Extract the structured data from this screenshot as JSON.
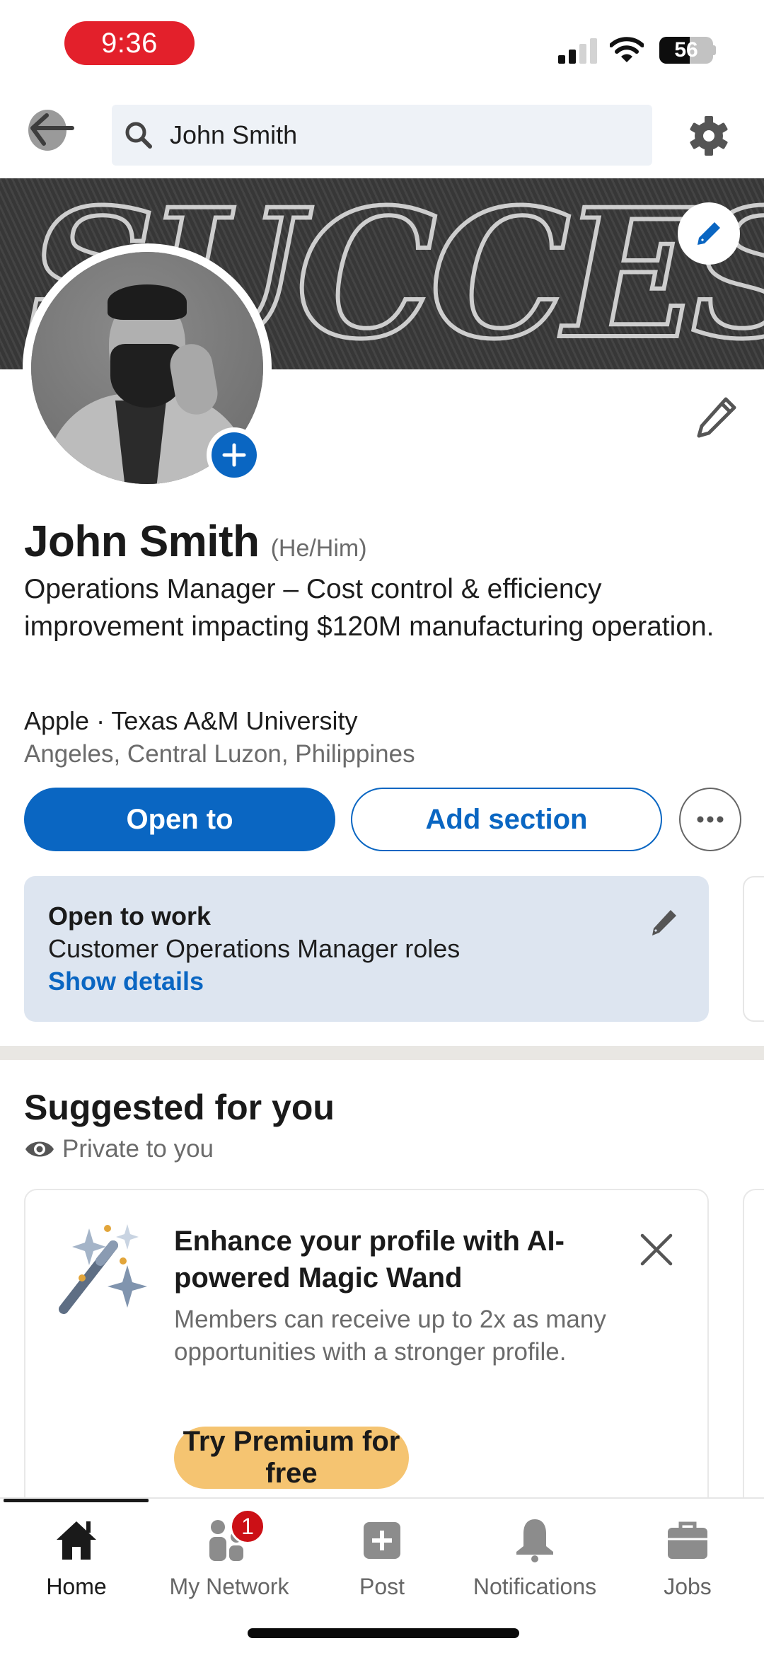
{
  "status_bar": {
    "time": "9:36",
    "battery_level": "56",
    "battery_fraction": 0.56,
    "signal_bars_active": 2,
    "signal_bars_total": 4,
    "icons": [
      "cellular-signal-icon",
      "wifi-icon",
      "battery-icon"
    ]
  },
  "top_nav": {
    "back_icon": "arrow-left-icon",
    "search_icon": "search-icon",
    "search_value": "John Smith",
    "settings_icon": "gear-icon"
  },
  "banner": {
    "image_text": "SUCCESS",
    "edit_icon": "pencil-icon"
  },
  "profile": {
    "add_photo_icon": "plus-icon",
    "edit_intro_icon": "pencil-icon",
    "name": "John Smith",
    "pronouns": "(He/Him)",
    "headline": "Operations Manager – Cost control & efficiency improvement impacting $120M manufacturing operation.",
    "affiliations": "Apple · Texas A&M University",
    "location": "Angeles, Central Luzon, Philippines"
  },
  "actions": {
    "open_to": "Open to",
    "add_section": "Add section",
    "more_icon": "more-horizontal-icon"
  },
  "open_to_work": {
    "title": "Open to work",
    "roles": "Customer Operations Manager roles",
    "link": "Show details",
    "edit_icon": "pencil-icon"
  },
  "suggested": {
    "title": "Suggested for you",
    "privacy": "Private to you",
    "privacy_icon": "eye-icon",
    "card": {
      "icon": "magic-wand-icon",
      "title": "Enhance your profile with AI-powered Magic Wand",
      "body": "Members can receive up to 2x as many opportunities with a stronger profile.",
      "cta": "Try Premium for free",
      "close_icon": "close-icon"
    }
  },
  "tabbar": {
    "tabs": [
      {
        "label": "Home",
        "icon": "home-icon",
        "active": true
      },
      {
        "label": "My Network",
        "icon": "people-icon",
        "badge": "1"
      },
      {
        "label": "Post",
        "icon": "plus-square-icon"
      },
      {
        "label": "Notifications",
        "icon": "bell-icon"
      },
      {
        "label": "Jobs",
        "icon": "briefcase-icon"
      }
    ]
  },
  "colors": {
    "brand_blue": "#0a66c2",
    "premium_gold": "#f5c471",
    "badge_red": "#cc1016",
    "time_pill_red": "#e3202b",
    "otw_card_bg": "#dde5f0"
  }
}
